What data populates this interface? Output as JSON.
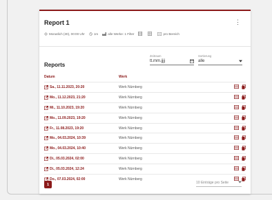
{
  "report": {
    "title": "Report 1",
    "menu_glyph": "⋮",
    "meta": {
      "schedule": "Monatlich (30), 00:00 Uhr",
      "count": "1m",
      "filter": "alle Werke: 1 Filter",
      "range": "pro Bereich"
    }
  },
  "reports_section": {
    "title": "Reports",
    "date_field": {
      "label": "Zeitraum",
      "value": "tt.mm.jjjj"
    },
    "sort_field": {
      "label": "Sortierung",
      "value": "alle"
    },
    "columns": {
      "datum": "Datum",
      "werk": "Werk"
    },
    "rows": [
      {
        "date": "Sa., 11.11.2023, 20:20",
        "werk": "Werk Nürnberg"
      },
      {
        "date": "Mo., 11.12.2023, 21:20",
        "werk": "Werk Nürnberg"
      },
      {
        "date": "Mi., 11.10.2023, 19:20",
        "werk": "Werk Nürnberg"
      },
      {
        "date": "Mo., 11.09.2023, 19:20",
        "werk": "Werk Nürnberg"
      },
      {
        "date": "Fr., 11.08.2023, 19:20",
        "werk": "Werk Nürnberg"
      },
      {
        "date": "Mo., 04.03.2024, 10:39",
        "werk": "Werk Nürnberg"
      },
      {
        "date": "Mo., 04.03.2024, 10:40",
        "werk": "Werk Nürnberg"
      },
      {
        "date": "Di., 05.03.2024, 02:00",
        "werk": "Werk Nürnberg"
      },
      {
        "date": "Di., 05.03.2024, 12:24",
        "werk": "Werk Nürnberg"
      },
      {
        "date": "Do., 07.03.2024, 02:00",
        "werk": "Werk Nürnberg"
      }
    ]
  },
  "pagination": {
    "current_page": "1",
    "per_page": "10 Einträge pro Seite"
  },
  "colors": {
    "accent": "#8b1a1a"
  }
}
